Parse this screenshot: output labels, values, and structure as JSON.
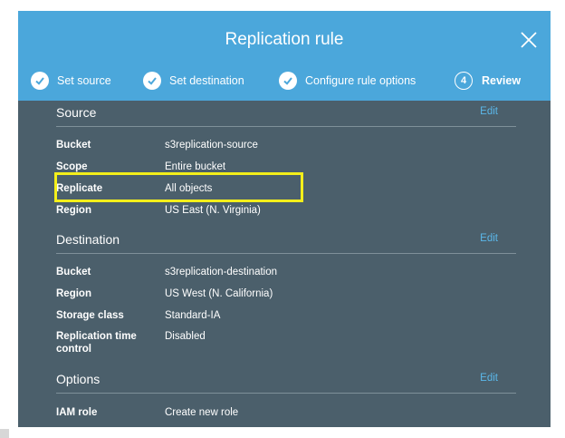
{
  "modal": {
    "title": "Replication rule",
    "close_icon": "close-icon"
  },
  "steps": [
    {
      "label": "Set source",
      "state": "done"
    },
    {
      "label": "Set destination",
      "state": "done"
    },
    {
      "label": "Configure rule options",
      "state": "done"
    },
    {
      "label": "Review",
      "number": "4",
      "state": "active"
    }
  ],
  "source": {
    "title": "Source",
    "edit": "Edit",
    "rows": [
      {
        "key": "Bucket",
        "value": "s3replication-source"
      },
      {
        "key": "Scope",
        "value": "Entire bucket"
      },
      {
        "key": "Replicate",
        "value": "All objects"
      },
      {
        "key": "Region",
        "value": "US East (N. Virginia)"
      }
    ]
  },
  "destination": {
    "title": "Destination",
    "edit": "Edit",
    "rows": [
      {
        "key": "Bucket",
        "value": "s3replication-destination"
      },
      {
        "key": "Region",
        "value": "US West (N. California)"
      },
      {
        "key": "Storage class",
        "value": "Standard-IA"
      },
      {
        "key": "Replication time control",
        "value": "Disabled"
      }
    ]
  },
  "options": {
    "title": "Options",
    "edit": "Edit",
    "rows": [
      {
        "key": "IAM role",
        "value": "Create new role"
      }
    ]
  },
  "colors": {
    "header": "#4ba7db",
    "body": "#4b5f6b",
    "link": "#5bb8ea",
    "highlight": "#f4ef1a"
  }
}
